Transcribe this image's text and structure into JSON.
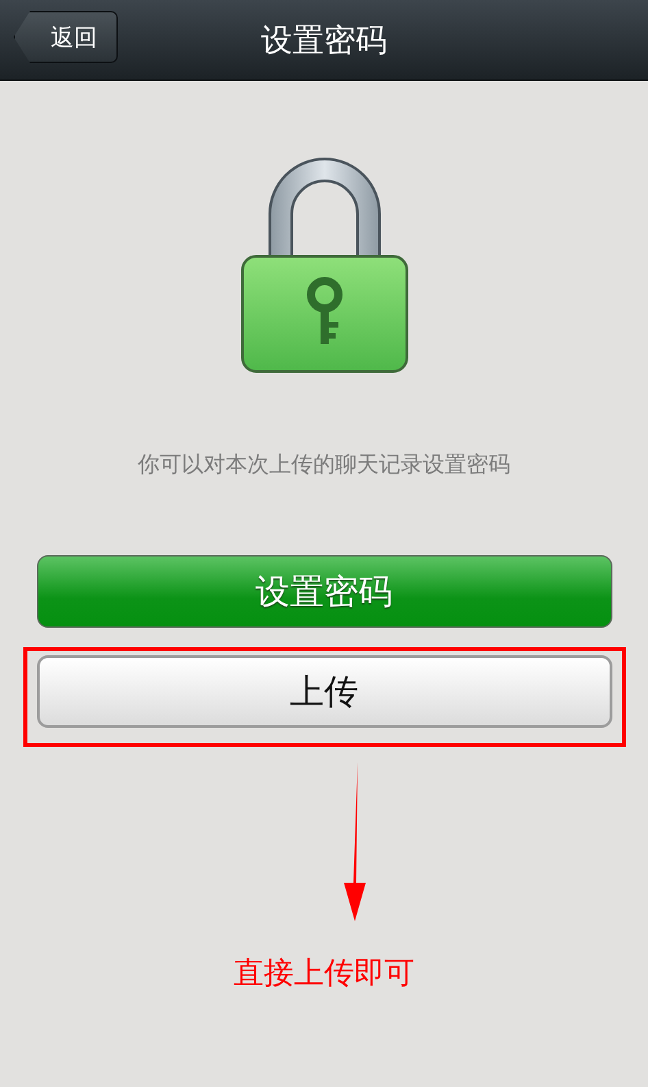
{
  "nav_bar": {
    "back_button": "返回",
    "title": "设置密码"
  },
  "description": "你可以对本次上传的聊天记录设置密码",
  "buttons": [
    {
      "label": "设置密码",
      "kind": "primary",
      "highlighted": false
    },
    {
      "label": "上传",
      "kind": "secondary",
      "highlighted": true
    }
  ],
  "annotation": {
    "note": "直接上传即可"
  }
}
